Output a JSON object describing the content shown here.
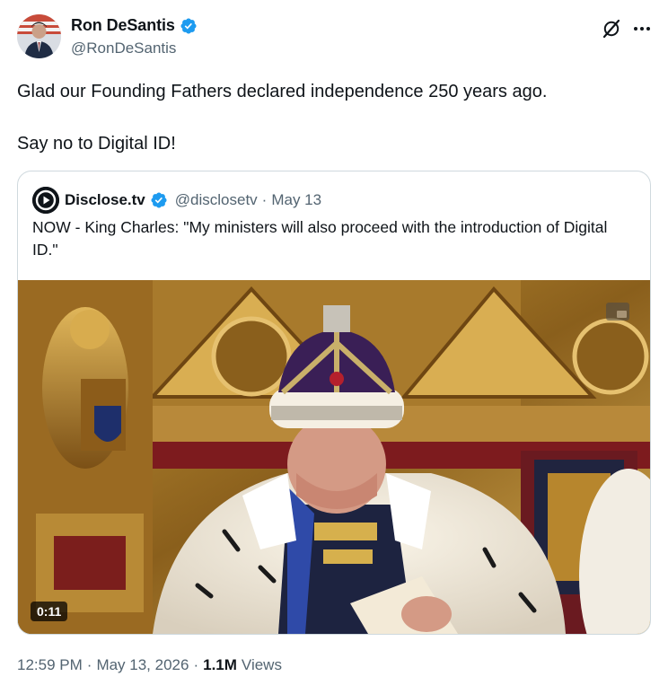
{
  "author": {
    "display_name": "Ron DeSantis",
    "handle": "@RonDeSantis",
    "verified": true,
    "verified_color": "#1d9bf0"
  },
  "actions": {
    "grok_icon": "grok-icon",
    "more_icon": "more-horizontal-icon"
  },
  "tweet": {
    "paragraphs": [
      "Glad our Founding Fathers declared independence 250 years ago.",
      "Say no to Digital ID!"
    ]
  },
  "quote": {
    "display_name": "Disclose.tv",
    "handle": "@disclosetv",
    "separator": "·",
    "date": "May 13",
    "verified": true,
    "text": "NOW - King Charles: \"My ministers will also proceed with the introduction of Digital ID.\"",
    "media": {
      "type": "video",
      "duration": "0:11"
    }
  },
  "meta": {
    "time": "12:59 PM",
    "separator1": "·",
    "date": "May 13, 2026",
    "separator2": "·",
    "views_count": "1.1M",
    "views_label": "Views"
  },
  "colors": {
    "text_primary": "#0f1419",
    "text_secondary": "#536471",
    "border": "#cfd9de",
    "verified": "#1d9bf0"
  }
}
